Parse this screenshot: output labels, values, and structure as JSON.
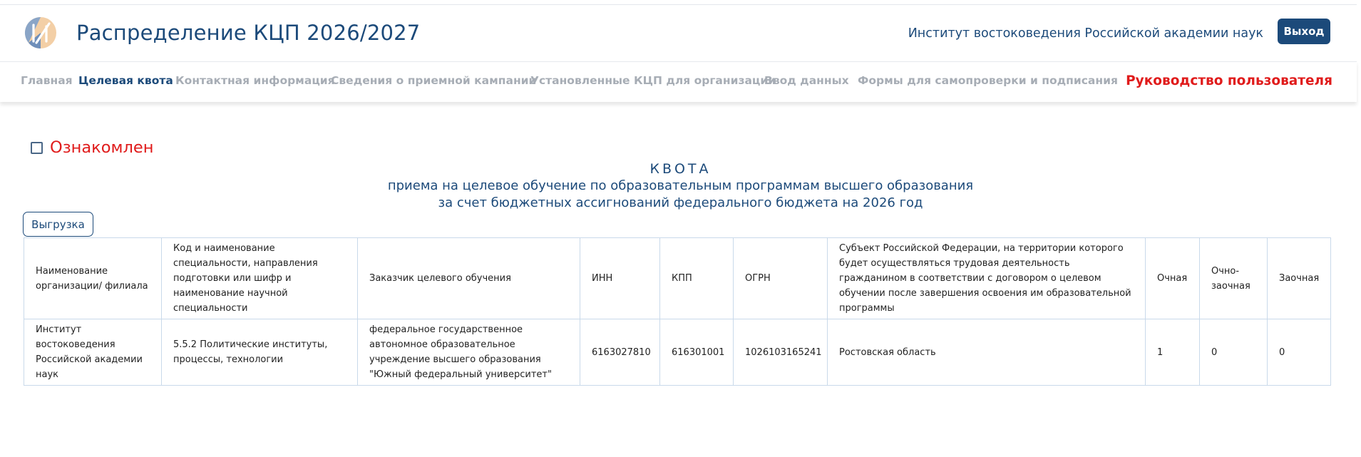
{
  "header": {
    "app_title": "Распределение КЦП 2026/2027",
    "org_name": "Институт востоковедения Российской академии наук",
    "logout_label": "Выход",
    "logo_icon": "institution-logo-icon"
  },
  "nav": {
    "items": [
      {
        "label": "Главная",
        "active": false
      },
      {
        "label": "Целевая квота",
        "active": true
      },
      {
        "label": "Контактная информация",
        "active": false
      },
      {
        "label": "Сведения о приемной кампании",
        "active": false
      },
      {
        "label": "Установленные КЦП для организации",
        "active": false
      },
      {
        "label": "Ввод данных",
        "active": false
      },
      {
        "label": "Формы для самопроверки и подписания",
        "active": false
      }
    ],
    "guide_label": "Руководство пользователя"
  },
  "ack": {
    "label": "Ознакомлен",
    "checked": false
  },
  "heading": {
    "line1": "КВОТА",
    "line2": "приема на целевое обучение по образовательным программам высшего образования",
    "line3": "за счет бюджетных ассигнований федерального бюджета на 2026 год"
  },
  "export_label": "Выгрузка",
  "table": {
    "headers": [
      "Наименование организации/ филиала",
      "Код и наименование специальности, направления подготовки или шифр и наименование научной специальности",
      "Заказчик целевого обучения",
      "ИНН",
      "КПП",
      "ОГРН",
      "Субъект Российской Федерации, на территории которого будет осуществляться трудовая деятельность гражданином в соответствии с договором о целевом обучении после завершения освоения им образовательной программы",
      "Очная",
      "Очно-заочная",
      "Заочная"
    ],
    "rows": [
      [
        "Институт востоковедения Российской академии наук",
        "5.5.2 Политические институты, процессы, технологии",
        "федеральное государственное автономное образовательное учреждение высшего образования \"Южный федеральный университет\"",
        "6163027810",
        "616301001",
        "1026103165241",
        "Ростовская область",
        "1",
        "0",
        "0"
      ]
    ]
  },
  "colors": {
    "primary": "#1c4a7a",
    "accent_red": "#e01b1b",
    "nav_inactive": "#a7adb5",
    "table_border": "#c9d9ea"
  }
}
